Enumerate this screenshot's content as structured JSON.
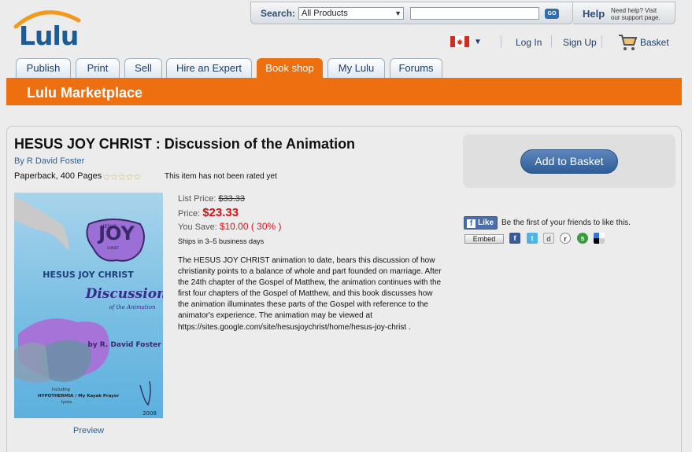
{
  "search": {
    "label": "Search:",
    "category": "All Products",
    "go": "GO"
  },
  "help": {
    "title": "Help",
    "text_line1": "Need help? Visit",
    "text_line2": "our support page."
  },
  "brand": {
    "logo": "Lulu"
  },
  "utility": {
    "login": "Log In",
    "signup": "Sign Up",
    "basket": "Basket"
  },
  "tabs": [
    {
      "label": "Publish"
    },
    {
      "label": "Print"
    },
    {
      "label": "Sell"
    },
    {
      "label": "Hire an Expert"
    },
    {
      "label": "Book shop"
    },
    {
      "label": "My Lulu"
    },
    {
      "label": "Forums"
    }
  ],
  "section_title": "Lulu Marketplace",
  "product": {
    "title": "HESUS JOY CHRIST : Discussion of the Animation",
    "author": "By R David Foster",
    "format": "Paperback, 400 Pages",
    "stars": "☆☆☆☆☆",
    "rating_text": "This item has not been rated yet",
    "list_price_label": "List Price:",
    "list_price": "$33.33",
    "price_label": "Price:",
    "price": "$23.33",
    "save_label": "You Save:",
    "save": "$10.00 ( 30% )",
    "ships": "Ships in 3–5 business days",
    "description": "The HESUS JOY CHRIST animation to date, bears this discussion of how christianity points to a balance of whole and part founded on marriage. After the 24th chapter of the Gospel of Matthew, the animation continues with the first four chapters of the Gospel of Matthew, and this book discusses how the animation illuminates these parts of the Gospel with reference to the animator's experience. The animation may be viewed at https://sites.google.com/site/hesusjoychrist/home/hesus-joy-christ .",
    "preview": "Preview"
  },
  "cover": {
    "joy": "JOY",
    "hesus": "HESUS",
    "christ_small": "CHRIST",
    "name": "HESUS JOY CHRIST",
    "discussion": "Discussion",
    "subtitle": "of the Animation",
    "author": "by R. David Foster",
    "including": "Including",
    "extra": "HYPOTHERMIA / My Kayak Prayer",
    "lyrics": "lyrics",
    "year": "2008"
  },
  "actions": {
    "add_to_basket": "Add to Basket",
    "like": "Like",
    "like_text": "Be the first of your friends to like this.",
    "embed": "Embed"
  },
  "colors": {
    "accent_orange": "#ee6f0f",
    "link_blue": "#2a5f9a",
    "price_red": "#d4161a"
  }
}
